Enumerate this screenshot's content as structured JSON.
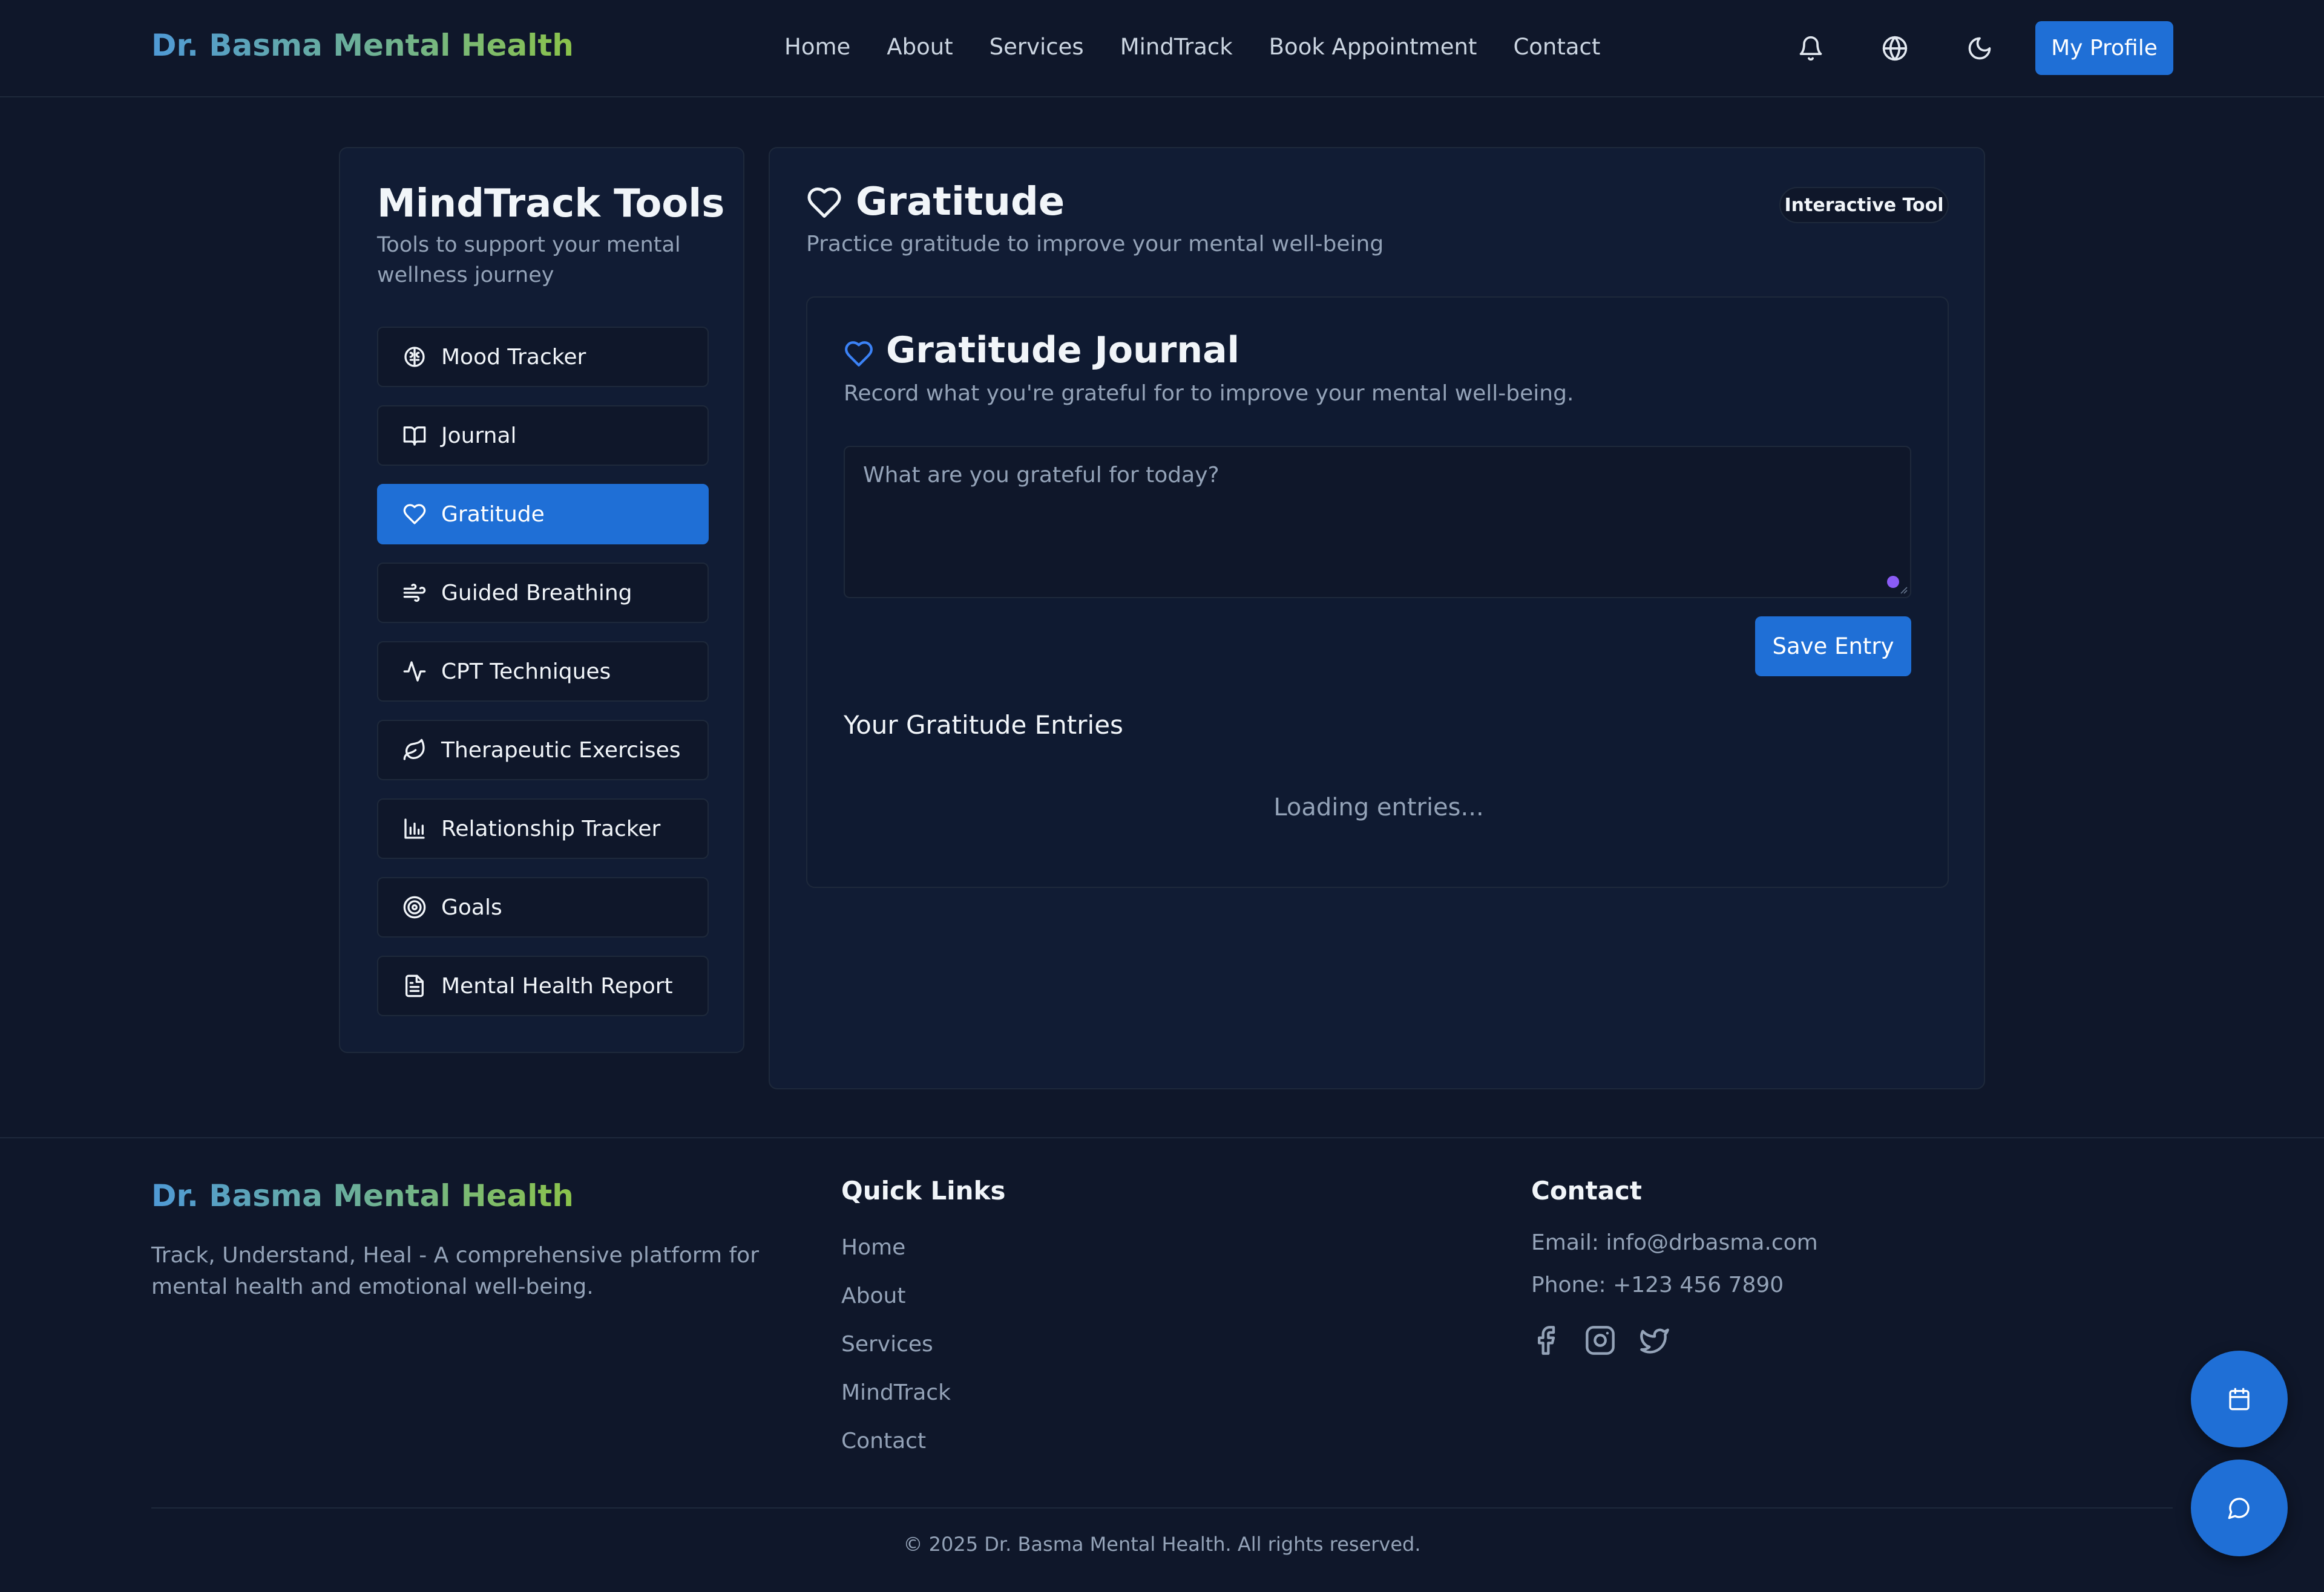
{
  "header": {
    "brand": "Dr. Basma Mental Health",
    "nav": [
      "Home",
      "About",
      "Services",
      "MindTrack",
      "Book Appointment",
      "Contact"
    ],
    "icons": [
      "bell-icon",
      "globe-icon",
      "moon-icon"
    ],
    "profile_label": "My Profile"
  },
  "sidebar": {
    "title": "MindTrack Tools",
    "subtitle": "Tools to support your mental wellness journey",
    "items": [
      {
        "label": "Mood Tracker",
        "icon": "brain-icon",
        "active": false
      },
      {
        "label": "Journal",
        "icon": "book-icon",
        "active": false
      },
      {
        "label": "Gratitude",
        "icon": "heart-icon",
        "active": true
      },
      {
        "label": "Guided Breathing",
        "icon": "wind-icon",
        "active": false
      },
      {
        "label": "CPT Techniques",
        "icon": "activity-icon",
        "active": false
      },
      {
        "label": "Therapeutic Exercises",
        "icon": "leaf-icon",
        "active": false
      },
      {
        "label": "Relationship Tracker",
        "icon": "bar-chart-icon",
        "active": false
      },
      {
        "label": "Goals",
        "icon": "target-icon",
        "active": false
      },
      {
        "label": "Mental Health Report",
        "icon": "file-text-icon",
        "active": false
      }
    ]
  },
  "main": {
    "title": "Gratitude",
    "subtitle": "Practice gratitude to improve your mental well-being",
    "badge": "Interactive Tool",
    "card": {
      "title": "Gratitude Journal",
      "subtitle": "Record what you're grateful for to improve your mental well-being.",
      "placeholder": "What are you grateful for today?",
      "value": "",
      "save_label": "Save Entry",
      "entries_title": "Your Gratitude Entries",
      "loading_text": "Loading entries..."
    }
  },
  "footer": {
    "brand": "Dr. Basma Mental Health",
    "description": "Track, Understand, Heal - A comprehensive platform for mental health and emotional well-being.",
    "quick_links_title": "Quick Links",
    "quick_links": [
      "Home",
      "About",
      "Services",
      "MindTrack",
      "Contact"
    ],
    "contact_title": "Contact",
    "email": "Email: info@drbasma.com",
    "phone": "Phone: +123 456 7890",
    "social": [
      "facebook-icon",
      "instagram-icon",
      "twitter-icon"
    ],
    "copyright": "© 2025 Dr. Basma Mental Health. All rights reserved."
  },
  "fabs": [
    "calendar-icon",
    "chat-icon"
  ],
  "colors": {
    "background": "#0f172a",
    "panel": "#111c34",
    "accent": "#1f6fd6",
    "muted_text": "#94a3b8",
    "heart_accent": "#3b82f6"
  }
}
